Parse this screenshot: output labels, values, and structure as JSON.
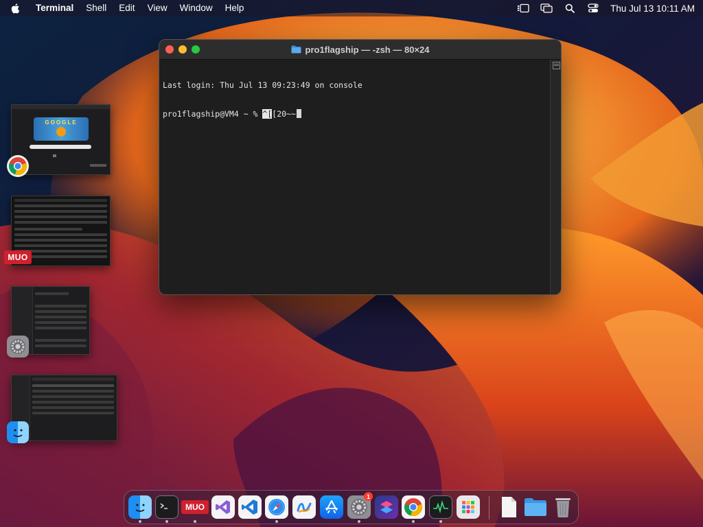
{
  "menubar": {
    "app_name": "Terminal",
    "menus": [
      "Shell",
      "Edit",
      "View",
      "Window",
      "Help"
    ],
    "clock": "Thu Jul 13  10:11 AM",
    "status_icons": [
      "stage-manager-icon",
      "screen-mirroring-icon",
      "spotlight-search-icon",
      "control-center-icon"
    ]
  },
  "terminal": {
    "title": "pro1flagship — -zsh — 80×24",
    "lines": {
      "login": "Last login: Thu Jul 13 09:23:49 on console",
      "prompt": "pro1flagship@VM4 ~ % ",
      "input_highlight": "^[",
      "input_rest": "[20~~"
    }
  },
  "stage_manager": {
    "apps": [
      "Google Chrome",
      "MUO",
      "System Settings",
      "Finder"
    ],
    "muo_label": "MUO",
    "google_letters": "GOOGLE"
  },
  "dock": {
    "muo_label": "MUO",
    "settings_badge": "1",
    "items": [
      "Finder",
      "Terminal",
      "MUO",
      "Visual Studio",
      "VS Code",
      "Safari",
      "Freeform",
      "App Store",
      "System Settings",
      "Shortcuts",
      "Google Chrome",
      "Activity Monitor",
      "Launchpad",
      "Document",
      "Downloads",
      "Trash"
    ]
  },
  "colors": {
    "terminal_bg": "#1e1e1e",
    "close": "#ff5f57",
    "minimize": "#febc2e",
    "maximize": "#28c840",
    "wallpaper_orange": "#f28a1e",
    "wallpaper_navy": "#0f1a3a"
  }
}
